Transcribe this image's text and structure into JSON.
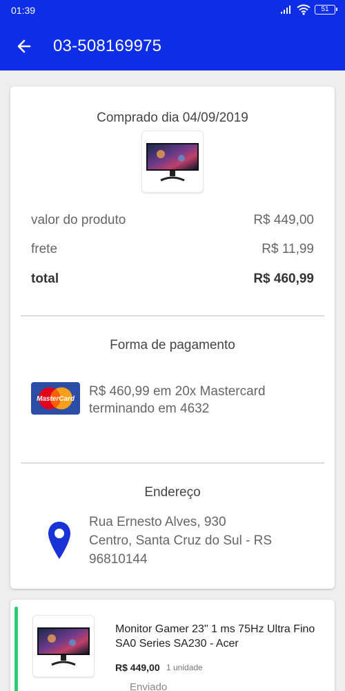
{
  "status_bar": {
    "time": "01:39",
    "battery": "51"
  },
  "header": {
    "title": "03-508169975"
  },
  "summary": {
    "purchase_date": "Comprado dia 04/09/2019",
    "rows": [
      {
        "label": "valor do produto",
        "value": "R$ 449,00"
      },
      {
        "label": "frete",
        "value": "R$ 11,99"
      },
      {
        "label": "total",
        "value": "R$ 460,99"
      }
    ]
  },
  "payment": {
    "title": "Forma de pagamento",
    "card_brand": "MasterCard",
    "line1": "R$ 460,99 em 20x Mastercard",
    "line2": "terminando em 4632"
  },
  "address": {
    "title": "Endereço",
    "line1": "Rua Ernesto Alves, 930",
    "line2": "Centro, Santa Cruz do Sul - RS",
    "line3": "96810144"
  },
  "item": {
    "name": "Monitor Gamer 23\" 1 ms 75Hz Ultra Fino SA0 Series SA230 - Acer",
    "price": "R$ 449,00",
    "quantity": "1 unidade",
    "status": "Enviado"
  },
  "colors": {
    "primary": "#0d2ee6",
    "accent_green": "#2ecc71",
    "pin_blue": "#1a33d6"
  }
}
